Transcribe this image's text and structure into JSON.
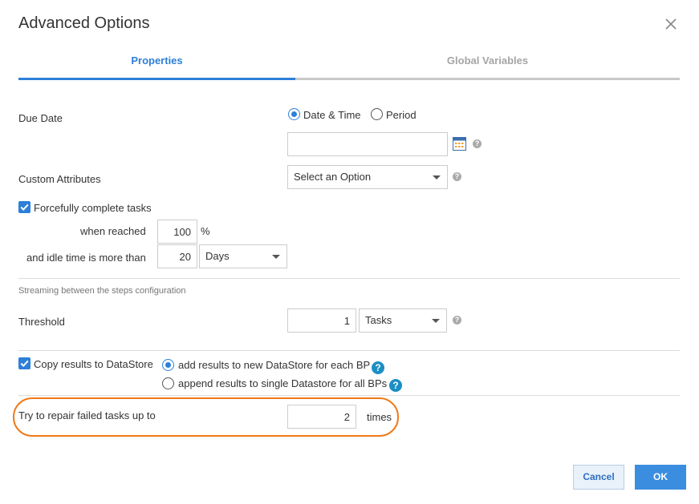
{
  "dialog": {
    "title": "Advanced Options"
  },
  "tabs": [
    {
      "label": "Properties",
      "active": true
    },
    {
      "label": "Global Variables",
      "active": false
    }
  ],
  "due_date": {
    "label": "Due Date",
    "options": [
      "Date & Time",
      "Period"
    ],
    "selected": "Date & Time",
    "date_value": ""
  },
  "custom_attributes": {
    "label": "Custom Attributes",
    "select_value": "Select an Option"
  },
  "force_complete": {
    "label": "Forcefully complete tasks",
    "checked": true,
    "when_reached_label": "when reached",
    "when_reached_value": "100",
    "percent_unit": "%",
    "idle_label": "and idle time is more than",
    "idle_value": "20",
    "idle_unit": "Days"
  },
  "streaming": {
    "section_title": "Streaming between the steps configuration",
    "threshold_label": "Threshold",
    "threshold_value": "1",
    "threshold_unit": "Tasks"
  },
  "copy_results": {
    "label": "Copy results to DataStore",
    "checked": true,
    "options": [
      "add results to new DataStore for each BP",
      "append results to single Datastore for all BPs"
    ],
    "selected": "add results to new DataStore for each BP"
  },
  "repair": {
    "label": "Try to repair failed tasks up to",
    "value": "2",
    "unit": "times"
  },
  "buttons": {
    "cancel": "Cancel",
    "ok": "OK"
  },
  "icons": {
    "close": "close-icon",
    "calendar": "calendar-icon",
    "help": "help-icon",
    "check": "check-icon"
  },
  "colors": {
    "accent": "#2d7fd8",
    "highlight": "#f07a1a",
    "help_teal": "#1a8fc4"
  }
}
